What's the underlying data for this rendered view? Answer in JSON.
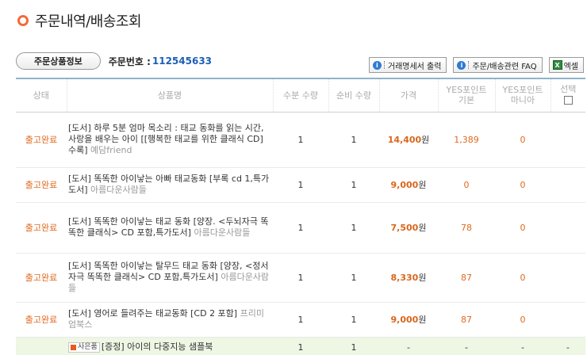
{
  "page": {
    "title": "주문내역/배송조회"
  },
  "order": {
    "tab_label": "주문상품정보",
    "number_label": "주문번호 :",
    "number": "112545633"
  },
  "actions": {
    "receipt": "거래명세서 출력",
    "faq": "주문/배송관련 FAQ",
    "excel": "엑셀",
    "info_glyph": "i",
    "excel_glyph": "X"
  },
  "headers": {
    "status": "상태",
    "product": "상품명",
    "qty_order": "수분 수량",
    "qty_net": "순비 수량",
    "price": "가격",
    "yes_basic_1": "YES포인트",
    "yes_basic_2": "기본",
    "yes_mania_1": "YES포인트",
    "yes_mania_2": "마니아",
    "select": "선택"
  },
  "rows": [
    {
      "status": "출고완료",
      "title": "[도서] 하루 5분 엄마 목소리 : 태교 동화를 읽는 시간, 사랑을 배우는 아이 [[행복한 태교를 위한 클래식 CD] 수록]",
      "publisher": "예담friend",
      "qty_order": "1",
      "qty_net": "1",
      "price": "14,400",
      "won": "원",
      "pt_basic": "1,389",
      "pt_mania": "0"
    },
    {
      "status": "출고완료",
      "title": "[도서] 똑똑한 아이낳는 아빠 태교동화 [부록 cd 1,특가도서]",
      "publisher": "아름다운사람들",
      "qty_order": "1",
      "qty_net": "1",
      "price": "9,000",
      "won": "원",
      "pt_basic": "0",
      "pt_mania": "0"
    },
    {
      "status": "출고완료",
      "title": "[도서] 똑똑한 아이낳는 태교 동화 [양장. <두뇌자극 똑똑한 클래식> CD 포함,특가도서]",
      "publisher": "아름다운사람들",
      "qty_order": "1",
      "qty_net": "1",
      "price": "7,500",
      "won": "원",
      "pt_basic": "78",
      "pt_mania": "0"
    },
    {
      "status": "출고완료",
      "title": "[도서] 똑똑한 아이낳는 탈무드 태교 동화 [양장, <정서 자극 똑똑한 클래식> CD 포함,특가도서]",
      "publisher": "아름다운사람들",
      "qty_order": "1",
      "qty_net": "1",
      "price": "8,330",
      "won": "원",
      "pt_basic": "87",
      "pt_mania": "0"
    },
    {
      "status": "출고완료",
      "title": "[도서] 영어로 들려주는 태교동화 [CD 2 포함]",
      "publisher": "프리미엄북스",
      "qty_order": "1",
      "qty_net": "1",
      "price": "9,000",
      "won": "원",
      "pt_basic": "87",
      "pt_mania": "0"
    }
  ],
  "gift_row": {
    "badge": "사은품",
    "title": "[증정] 아이의 다중지능 샘플북",
    "qty_order": "1",
    "qty_net": "1",
    "price": "-",
    "pt_basic": "-",
    "pt_mania": "-",
    "select": "-"
  },
  "colors": {
    "accent": "#f26b3a",
    "status": "#e06a1f",
    "order_no": "#1b5fb8",
    "gift_bg": "#eef6e4"
  }
}
